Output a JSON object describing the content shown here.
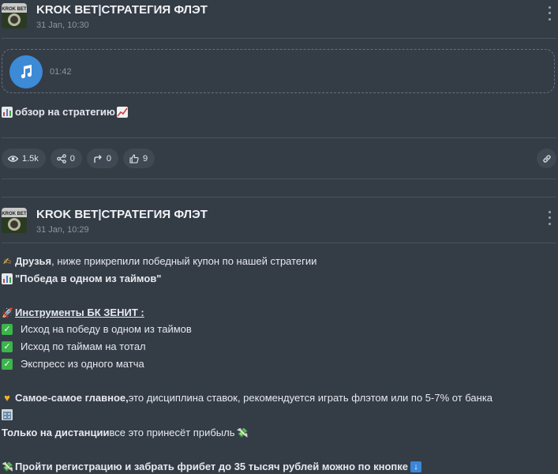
{
  "posts": [
    {
      "channel_name": "KROK BET|СТРАТЕГИЯ ФЛЭТ",
      "date": "31 Jan, 10:30",
      "avatar_text": "KROK BET",
      "audio": {
        "duration": "01:42"
      },
      "caption": "обзор на стратегию",
      "stats": {
        "views": "1.5k",
        "shares": "0",
        "forwards": "0",
        "likes": "9"
      }
    },
    {
      "channel_name": "KROK BET|СТРАТЕГИЯ ФЛЭТ",
      "date": "31 Jan, 10:29",
      "avatar_text": "KROK BET",
      "lines": {
        "l1_bold": "Друзья",
        "l1_rest": ", ниже прикрепили победный купон по нашей стратегии",
        "l2": "\"Победа в одном из таймов\"",
        "l3": "Инструменты БК ЗЕНИТ :",
        "l4": "Исход на победу в одном из таймов",
        "l5": "Исход по таймам на тотал",
        "l6": "Экспресс из одного матча",
        "l7_bold": "Самое-самое главное,",
        "l7_rest": " это дисциплина ставок, рекомендуется играть флэтом или по 5-7% от банка",
        "l8_bold": "Только на дистанции",
        "l8_rest": " все это принесёт прибыль",
        "l9": "Пройти регистрацию и забрать фрибет до 35 тысяч рублей можно по кнопке"
      }
    }
  ],
  "colors": {
    "background": "#343c46",
    "accent": "#3d8ad6",
    "pill": "#3f4853",
    "check": "#3bb54a"
  }
}
